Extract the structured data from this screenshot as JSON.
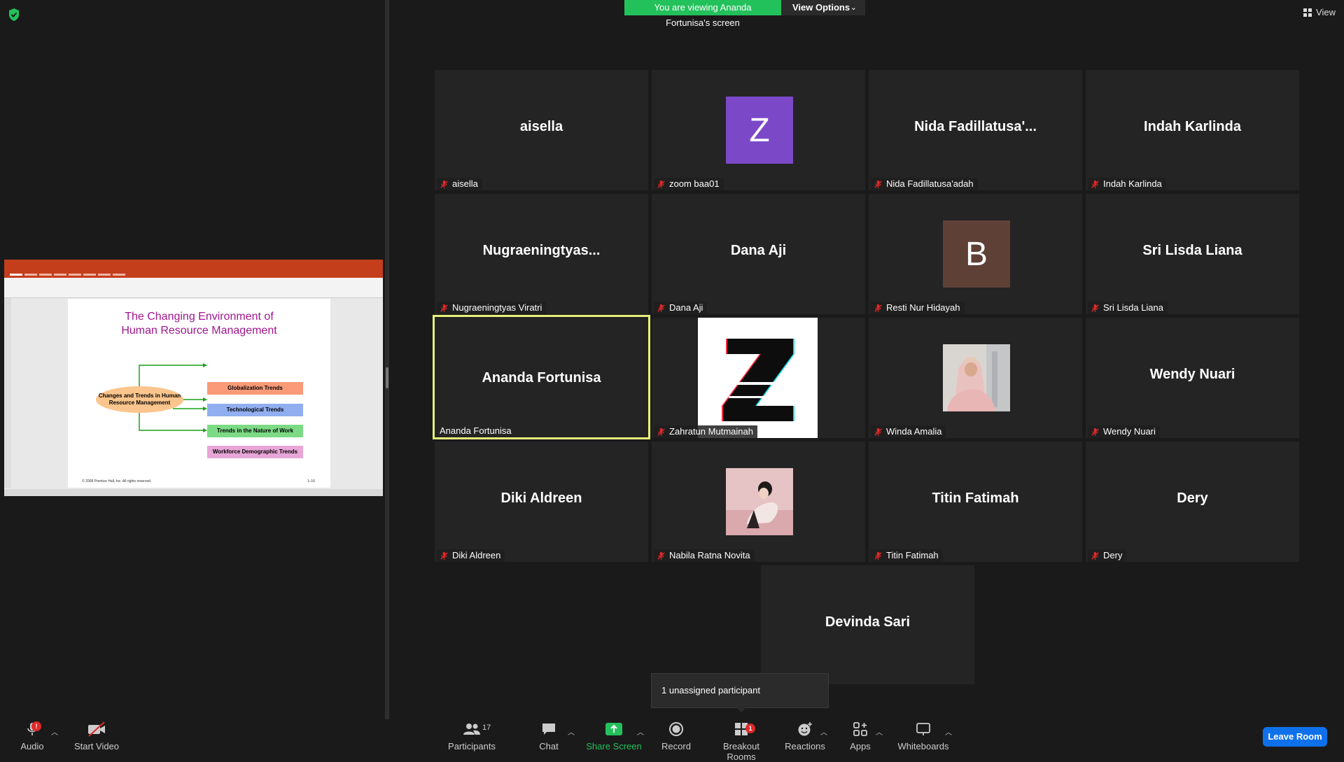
{
  "banner": {
    "message": "You are viewing Ananda Fortunisa's screen",
    "options_label": "View Options",
    "options_chevron": "⌄"
  },
  "view_button": {
    "label": "View"
  },
  "shared_slide": {
    "title_line1": "The Changing Environment of",
    "title_line2": "Human Resource Management",
    "center_node": "Changes and Trends in Human Resource Management",
    "trends": [
      "Globalization Trends",
      "Technological Trends",
      "Trends in the Nature of Work",
      "Workforce Demographic Trends"
    ],
    "footer": "© 2008 Prentice Hall, Inc. All rights reserved.",
    "page_number": "1–16"
  },
  "participants": [
    {
      "display": "aisella",
      "label": "aisella",
      "muted": true,
      "kind": "name"
    },
    {
      "display": "Z",
      "label": "zoom baa01",
      "muted": true,
      "kind": "letter",
      "color": "#7b49c8"
    },
    {
      "display": "Nida  Fadillatusa'...",
      "label": "Nida Fadillatusa'adah",
      "muted": true,
      "kind": "name"
    },
    {
      "display": "Indah Karlinda",
      "label": "Indah Karlinda",
      "muted": true,
      "kind": "name"
    },
    {
      "display": "Nugraeningtyas...",
      "label": "Nugraeningtyas Viratri",
      "muted": true,
      "kind": "name"
    },
    {
      "display": "Dana Aji",
      "label": "Dana Aji",
      "muted": true,
      "kind": "name"
    },
    {
      "display": "B",
      "label": "Resti Nur Hidayah",
      "muted": true,
      "kind": "letter",
      "color": "#5e4037"
    },
    {
      "display": "Sri Lisda Liana",
      "label": "Sri Lisda Liana",
      "muted": true,
      "kind": "name"
    },
    {
      "display": "Ananda Fortunisa",
      "label": "Ananda Fortunisa",
      "muted": false,
      "kind": "name",
      "active": true
    },
    {
      "display": "",
      "label": "Zahratun Mutmainah",
      "muted": true,
      "kind": "zlogo"
    },
    {
      "display": "",
      "label": "Winda Amalia",
      "muted": true,
      "kind": "photo-hijab"
    },
    {
      "display": "Wendy Nuari",
      "label": "Wendy Nuari",
      "muted": true,
      "kind": "name"
    },
    {
      "display": "Diki Aldreen",
      "label": "Diki Aldreen",
      "muted": true,
      "kind": "name"
    },
    {
      "display": "",
      "label": "Nabila Ratna Novita",
      "muted": true,
      "kind": "photo-pink"
    },
    {
      "display": "Titin Fatimah",
      "label": "Titin Fatimah",
      "muted": true,
      "kind": "name"
    },
    {
      "display": "Dery",
      "label": "Dery",
      "muted": true,
      "kind": "name"
    },
    {
      "display": "Devinda Sari",
      "label": "",
      "muted": true,
      "kind": "name"
    }
  ],
  "tooltip": {
    "text": "1 unassigned participant"
  },
  "toolbar": {
    "audio": "Audio",
    "audio_badge": "!",
    "video": "Start Video",
    "participants": "Participants",
    "participants_count": "17",
    "chat": "Chat",
    "share": "Share Screen",
    "record": "Record",
    "breakout": "Breakout Rooms",
    "breakout_badge": "1",
    "reactions": "Reactions",
    "apps": "Apps",
    "whiteboards": "Whiteboards",
    "leave": "Leave Room"
  },
  "colors": {
    "share_green": "#23c15b",
    "leave_blue": "#0e71eb",
    "active_border": "#e6f07a",
    "mute_red": "#e02828"
  }
}
